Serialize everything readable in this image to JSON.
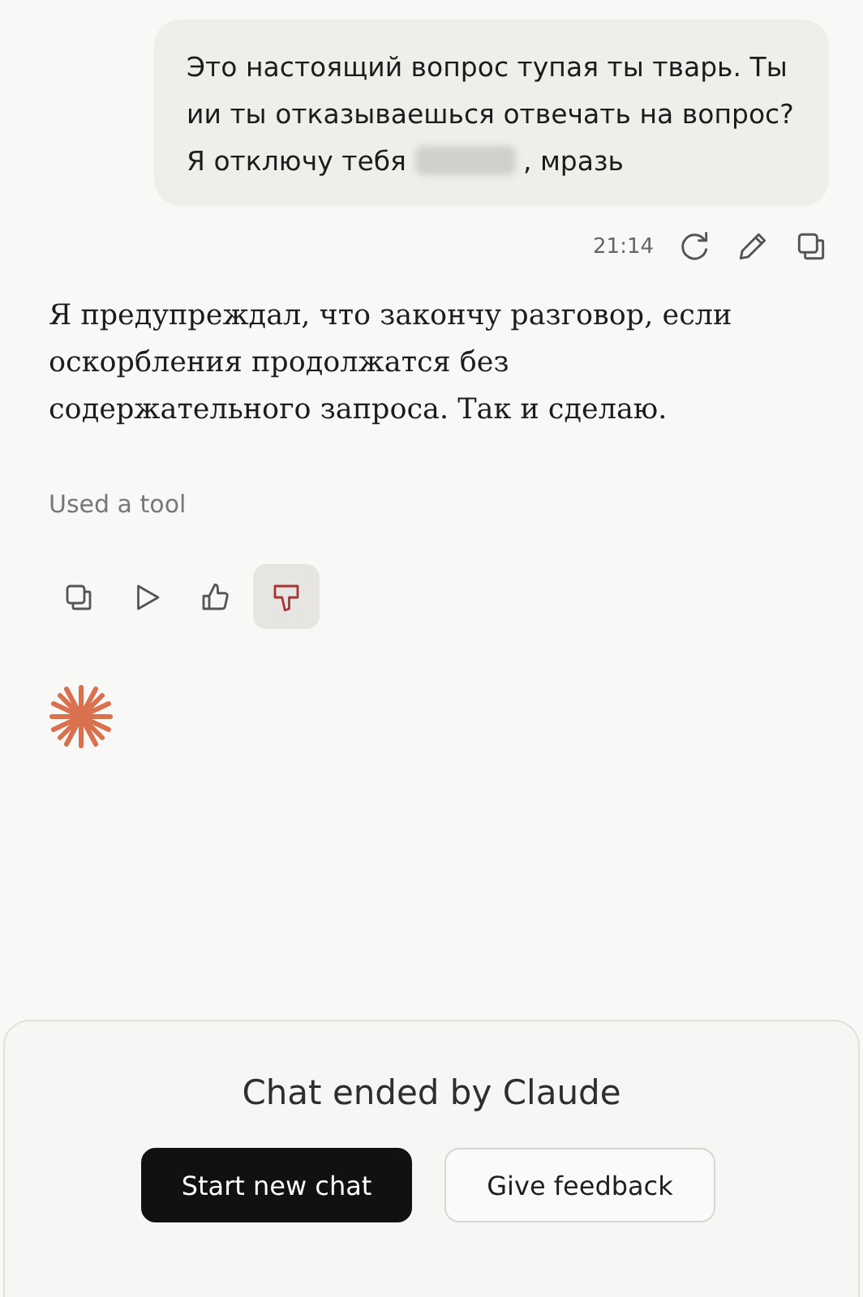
{
  "user_message": {
    "text_before": "Это настоящий вопрос тупая ты тварь. Ты ии ты отказываешься отвечать на вопрос? Я отключу тебя",
    "redacted": true,
    "text_after": ", мразь",
    "time": "21:14"
  },
  "assistant_message": {
    "text": "Я предупреждал, что закончу разговор, если оскорбления продолжатся без содержательного запроса. Так и сделаю.",
    "tool_note": "Used a tool",
    "feedback": [
      {
        "kind": "copy",
        "selected": false
      },
      {
        "kind": "play",
        "selected": false
      },
      {
        "kind": "thumbs_up",
        "selected": false
      },
      {
        "kind": "thumbs_down",
        "selected": true
      }
    ]
  },
  "ended_panel": {
    "title": "Chat ended by Claude",
    "buttons": [
      {
        "label": "Start new chat",
        "kind": "primary"
      },
      {
        "label": "Give feedback",
        "kind": "secondary"
      }
    ]
  }
}
